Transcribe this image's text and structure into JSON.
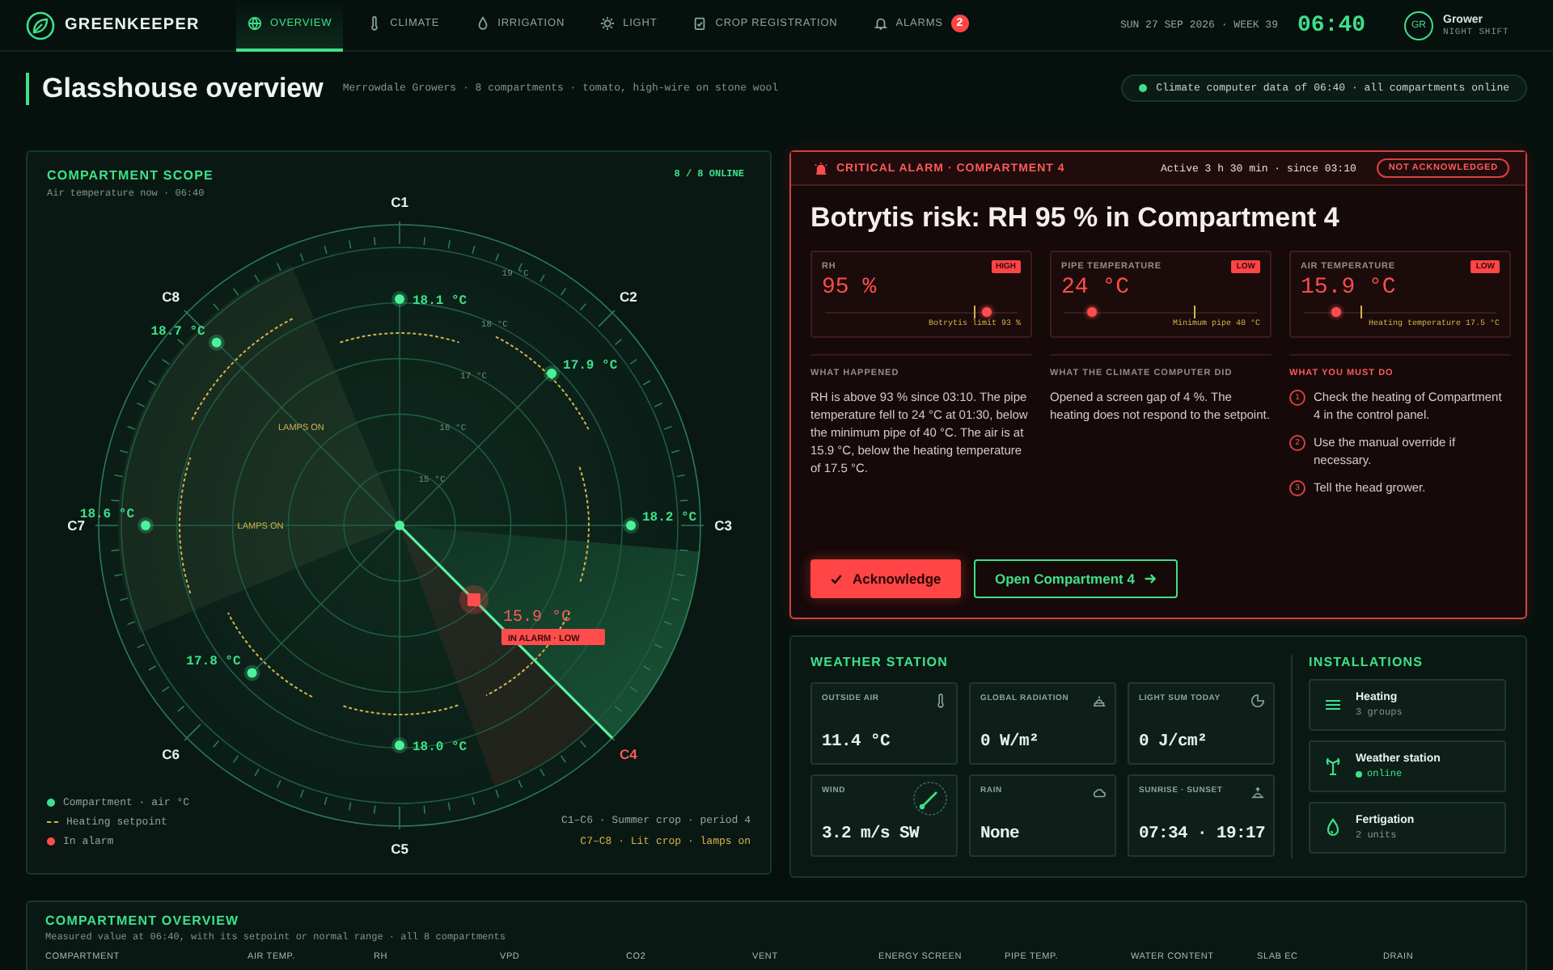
{
  "header": {
    "brand": "GREENKEEPER",
    "nav": [
      {
        "label": "OVERVIEW",
        "selected": true
      },
      {
        "label": "CLIMATE",
        "selected": false
      },
      {
        "label": "IRRIGATION",
        "selected": false
      },
      {
        "label": "LIGHT",
        "selected": false
      },
      {
        "label": "CROP REGISTRATION",
        "selected": false
      },
      {
        "label": "ALARMS",
        "selected": false,
        "badge": "2"
      }
    ],
    "date": "SUN 27 SEP 2026 · WEEK 39",
    "time": "06:40",
    "user": {
      "initials": "GR",
      "name": "Grower",
      "shift": "NIGHT SHIFT"
    }
  },
  "page": {
    "title": "Glasshouse overview",
    "subtitle": "Merrowdale Growers · 8 compartments · tomato, high-wire on stone wool",
    "status": {
      "online": true,
      "text": "Climate computer data of 06:40 · all compartments online"
    }
  },
  "scope": {
    "title": "COMPARTMENT SCOPE",
    "subtitle": "Air temperature now · 06:40",
    "online": "8 / 8 ONLINE",
    "rings": [
      "15 °C",
      "16 °C",
      "17 °C",
      "18 °C",
      "19 °C"
    ],
    "compartments": [
      {
        "name": "C1",
        "reading": "18.1 °C",
        "lit": false,
        "alarm": false
      },
      {
        "name": "C8",
        "reading": "18.7 °C",
        "lit": true,
        "note": "LAMPS ON",
        "alarm": false
      },
      {
        "name": "C2",
        "reading": "17.9 °C",
        "lit": false,
        "alarm": false
      },
      {
        "name": "C7",
        "reading": "18.6 °C",
        "lit": true,
        "note": "LAMPS ON",
        "alarm": false
      },
      {
        "name": "C3",
        "reading": "18.2 °C",
        "lit": false,
        "alarm": false
      },
      {
        "name": "C6",
        "reading": "17.8 °C",
        "lit": false,
        "alarm": false
      },
      {
        "name": "C4",
        "reading": "15.9 °C",
        "lit": false,
        "alarm": true,
        "alarm_label": "IN ALARM · LOW"
      },
      {
        "name": "C5",
        "reading": "18.0 °C",
        "lit": false,
        "alarm": false
      }
    ],
    "legend": [
      {
        "kind": "dot",
        "label": "Compartment · air °C"
      },
      {
        "kind": "dash",
        "label": "Heating setpoint"
      },
      {
        "kind": "alarm",
        "label": "In alarm"
      }
    ],
    "notes": [
      {
        "text": "C1–C6 · Summer crop · period 4",
        "color": "#8fa89a"
      },
      {
        "text": "C7–C8 · Lit crop · lamps on",
        "color": "#d4b44a"
      }
    ]
  },
  "alarm": {
    "heading": "CRITICAL ALARM · COMPARTMENT 4",
    "active": "Active 3 h 30 min · since 03:10",
    "acknowledged": false,
    "ack_label": "NOT ACKNOWLEDGED",
    "headline": "Botrytis risk: RH 95 % in Compartment 4",
    "metrics": [
      {
        "label": "RH",
        "flag": "HIGH",
        "value": "95 %",
        "level": 0.84,
        "limit": {
          "label": "Botrytis limit 93 %",
          "level": 0.77
        }
      },
      {
        "label": "PIPE TEMPERATURE",
        "flag": "LOW",
        "value": "24 °C",
        "level": 0.14,
        "limit": {
          "label": "Minimum pipe 40 °C",
          "level": 0.67
        }
      },
      {
        "label": "AIR TEMPERATURE",
        "flag": "LOW",
        "value": "15.9 °C",
        "level": 0.17,
        "limit": {
          "label": "Heating temperature 17.5 °C",
          "level": 0.29
        }
      }
    ],
    "sections": [
      {
        "title": "WHAT HAPPENED",
        "text": "RH is above 93 % since 03:10. The pipe temperature fell to 24 °C at 01:30, below the minimum pipe of 40 °C. The air is at 15.9 °C, below the heating temperature of 17.5 °C."
      },
      {
        "title": "WHAT THE CLIMATE COMPUTER DID",
        "text": "Opened a screen gap of 4 %. The heating does not respond to the setpoint."
      }
    ],
    "steps_title": "WHAT YOU MUST DO",
    "steps": [
      {
        "number": "1",
        "text": "Check the heating of Compartment 4 in the control panel."
      },
      {
        "number": "2",
        "text": "Use the manual override if necessary."
      },
      {
        "number": "3",
        "text": "Tell the head grower."
      }
    ],
    "buttons": [
      {
        "kind": "primary",
        "label": "Acknowledge"
      },
      {
        "kind": "secondary",
        "label": "Open Compartment 4"
      }
    ]
  },
  "weather": {
    "title": "WEATHER STATION",
    "tiles": [
      {
        "label": "OUTSIDE AIR",
        "value": "11.4 °C"
      },
      {
        "label": "GLOBAL RADIATION",
        "value": "0 W/m²"
      },
      {
        "label": "LIGHT SUM TODAY",
        "value": "0 J/cm²"
      },
      {
        "label": "WIND",
        "value": "3.2 m/s SW"
      },
      {
        "label": "RAIN",
        "value": "None"
      },
      {
        "label": "SUNRISE · SUNSET",
        "value": "07:34 · 19:17"
      }
    ]
  },
  "installations": {
    "title": "INSTALLATIONS",
    "items": [
      {
        "name": "Heating",
        "detail": "3 groups",
        "online": false
      },
      {
        "name": "Weather station",
        "detail": "online",
        "online": true
      },
      {
        "name": "Fertigation",
        "detail": "2 units",
        "online": false
      }
    ]
  },
  "overview": {
    "title": "COMPARTMENT OVERVIEW",
    "subtitle": "Measured value at 06:40, with its setpoint or normal range · all 8 compartments",
    "columns": [
      "COMPARTMENT",
      "AIR TEMP.",
      "RH",
      "VPD",
      "CO2",
      "VENT",
      "ENERGY SCREEN",
      "PIPE TEMP.",
      "WATER CONTENT",
      "SLAB EC",
      "DRAIN"
    ]
  }
}
